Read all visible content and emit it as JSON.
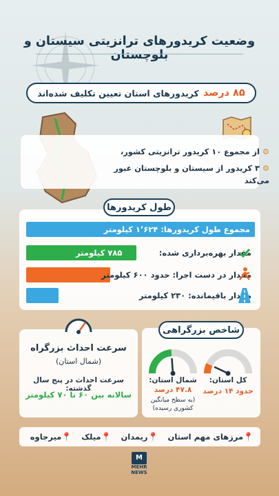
{
  "title": "وضعیت کریدورهای ترانزیتی سیستان و بلوچستان",
  "headline": {
    "percent": "۸۵ درصد",
    "text": "کریدورهای استان تعیین تکلیف شده‌اند"
  },
  "info": {
    "bullet1": "از مجموع ۱۰ کریدور ترانزیتی کشور،",
    "bullet2_line1": "۳ کریدور از سیستان و بلوچستان  عبور",
    "bullet2_line2": "می‌کند"
  },
  "length": {
    "heading": "طول کریدورها",
    "total": "مجموع طول کریدورها: ۱٬۶۲۴ کیلومتر",
    "built_value": "۷۸۵ کیلومتر",
    "built_label": "مقدار بهره‌برداری شده:",
    "progress": "مقدار در دست اجرا: حدود ۶۰۰ کیلومتر",
    "remaining": "مقدار باقیمانده: ۲۳۰ کیلومتر",
    "bar_values_km": [
      1624,
      785,
      600,
      230
    ],
    "colors": {
      "total": "#3aa7e0",
      "built": "#2eae4a",
      "progress": "#ef6a25",
      "remaining": "#3aa7e0"
    }
  },
  "speed": {
    "heading": "سرعت احداث بزرگراه",
    "sub": "(شمال استان)",
    "line1": "سرعت احداث در پنج سال گذشته:",
    "line2": "سالانه بین ۶۰ تا ۷۰ کیلومتر"
  },
  "highway_index": {
    "heading": "شاخص بزرگراهی",
    "province_label": "کل استان:",
    "province_value": "حدود ۱۴ درصد",
    "province_level": 0.14,
    "north_label": "شمال استان:",
    "north_value": "۴۷.۸ درصد",
    "north_note1": "(به سطح میانگین",
    "north_note2": "کشوری رسیده)",
    "north_level": 0.478
  },
  "borders": {
    "heading": "مرزهای مهم استان",
    "items": [
      "ریمدان",
      "میلک",
      "میرجاوه"
    ]
  },
  "logo": {
    "text": "MEHR NEWS"
  }
}
